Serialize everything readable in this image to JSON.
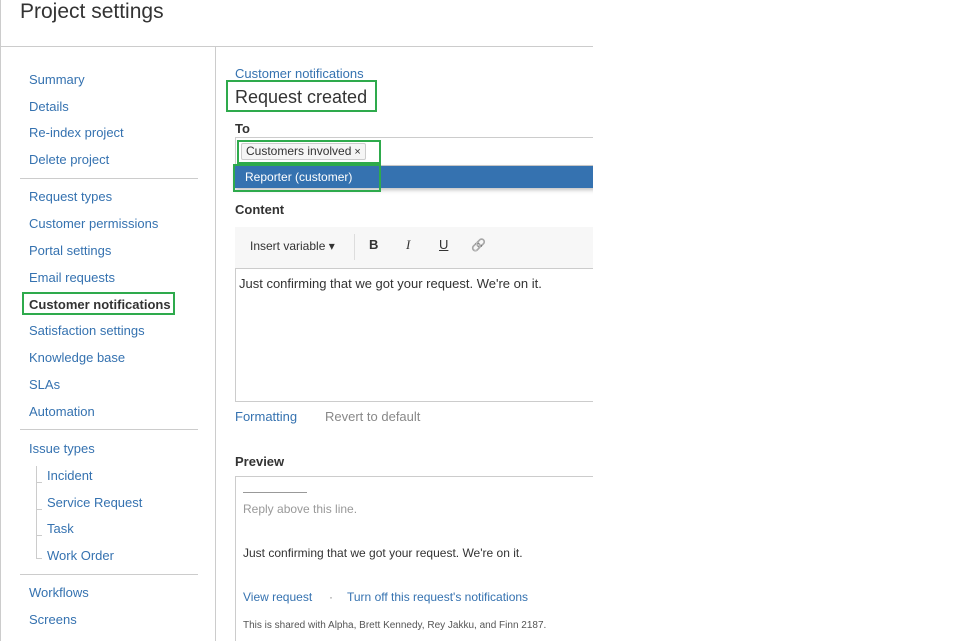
{
  "page_title": "Project settings",
  "sidebar": {
    "group1": [
      "Summary",
      "Details",
      "Re-index project",
      "Delete project"
    ],
    "group2": [
      "Request types",
      "Customer permissions",
      "Portal settings",
      "Email requests",
      "Customer notifications",
      "Satisfaction settings",
      "Knowledge base",
      "SLAs",
      "Automation"
    ],
    "issue_types": {
      "label": "Issue types",
      "children": [
        "Incident",
        "Service Request",
        "Task",
        "Work Order"
      ]
    },
    "group4": [
      "Workflows",
      "Screens"
    ],
    "active": "Customer notifications"
  },
  "main": {
    "breadcrumb": "Customer notifications",
    "heading": "Request created",
    "to_label": "To",
    "recipient_chip": "Customers involved",
    "chip_remove": "×",
    "dropdown_option": "Reporter (customer)",
    "content_label": "Content",
    "toolbar": {
      "insert_variable": "Insert variable ▾",
      "bold": "B",
      "italic": "I",
      "underline": "U",
      "link_icon": "🔗"
    },
    "editor_text": "Just confirming that we got your request. We're on it.",
    "formatting_link": "Formatting",
    "revert_link": "Revert to default",
    "preview_label": "Preview",
    "preview": {
      "reply_line": "Reply above this line.",
      "body": "Just confirming that we got your request. We're on it.",
      "view_request": "View request",
      "separator": "·",
      "turn_off": "Turn off this request's notifications",
      "shared": "This is shared with Alpha, Brett Kennedy, Rey Jakku, and Finn 2187."
    }
  },
  "colors": {
    "link": "#3572b0",
    "highlight": "#2eaa4c",
    "dropdown_bg": "#3572b0"
  }
}
